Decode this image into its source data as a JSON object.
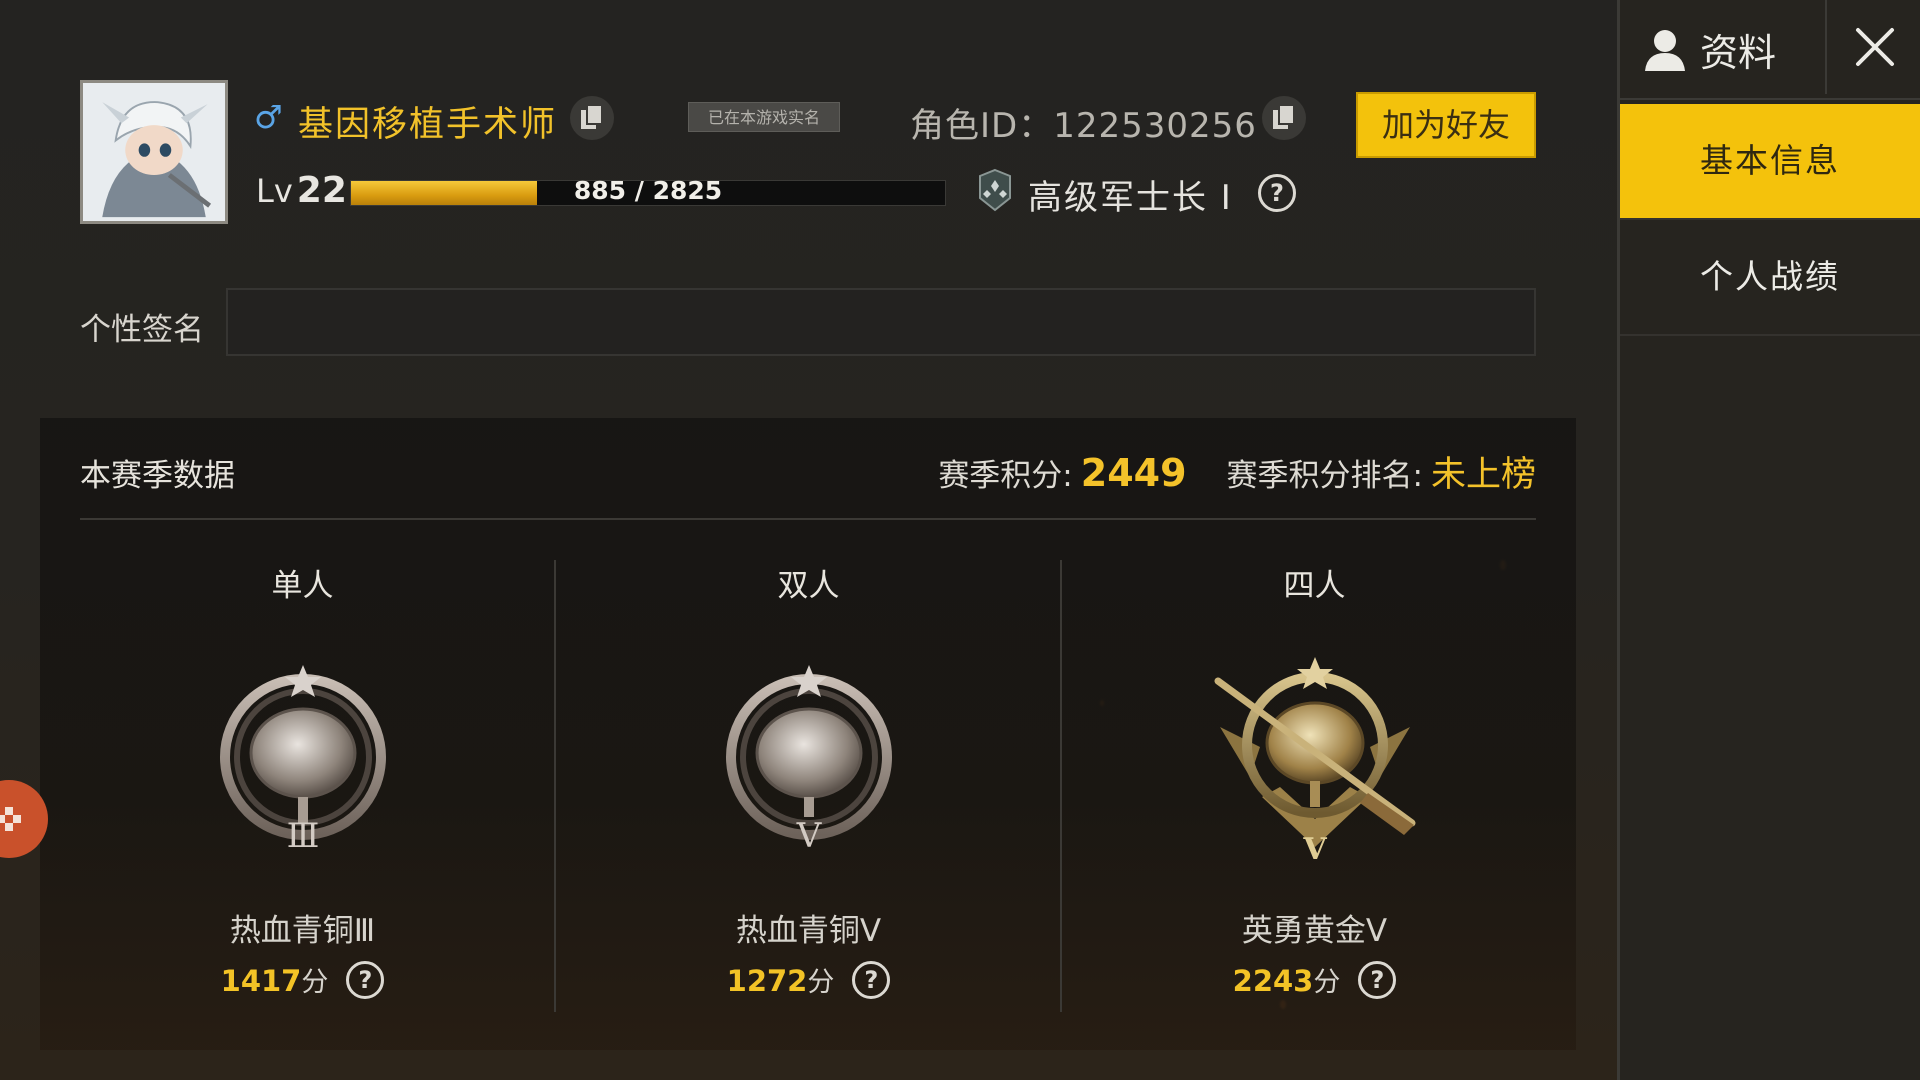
{
  "header": {
    "gender_symbol": "♂",
    "player_name": "基因移植手术师",
    "realname_badge": "已在本游戏实名",
    "role_id": "角色ID：122530256",
    "add_friend_label": "加为好友",
    "level_prefix": "Lv",
    "level": "22",
    "xp_text": "885 / 2825",
    "xp_progress": 0.313,
    "rank_title": "高级军士长 I",
    "help_glyph": "?"
  },
  "signature": {
    "label": "个性签名",
    "value": ""
  },
  "season": {
    "title": "本赛季数据",
    "points_label": "赛季积分:",
    "points_value": "2449",
    "ranking_label": "赛季积分排名:",
    "ranking_value": "未上榜",
    "modes": [
      {
        "label": "单人",
        "tier": "热血青铜Ⅲ",
        "score": "1417",
        "unit": "分",
        "badge_numeral": "Ⅲ"
      },
      {
        "label": "双人",
        "tier": "热血青铜Ⅴ",
        "score": "1272",
        "unit": "分",
        "badge_numeral": "V"
      },
      {
        "label": "四人",
        "tier": "英勇黄金Ⅴ",
        "score": "2243",
        "unit": "分",
        "badge_numeral": "V"
      }
    ]
  },
  "side": {
    "profile_tab": "资料",
    "nav": [
      "基本信息",
      "个人战绩"
    ]
  },
  "colors": {
    "accent_yellow": "#f4c20c",
    "score_yellow": "#f3c326",
    "bronze": "#9a8f86",
    "gold": "#b4954f"
  },
  "icons": [
    "person-icon",
    "close-icon",
    "copy-icon",
    "help-icon",
    "rank-insignia-icon",
    "gamepad-icon"
  ]
}
